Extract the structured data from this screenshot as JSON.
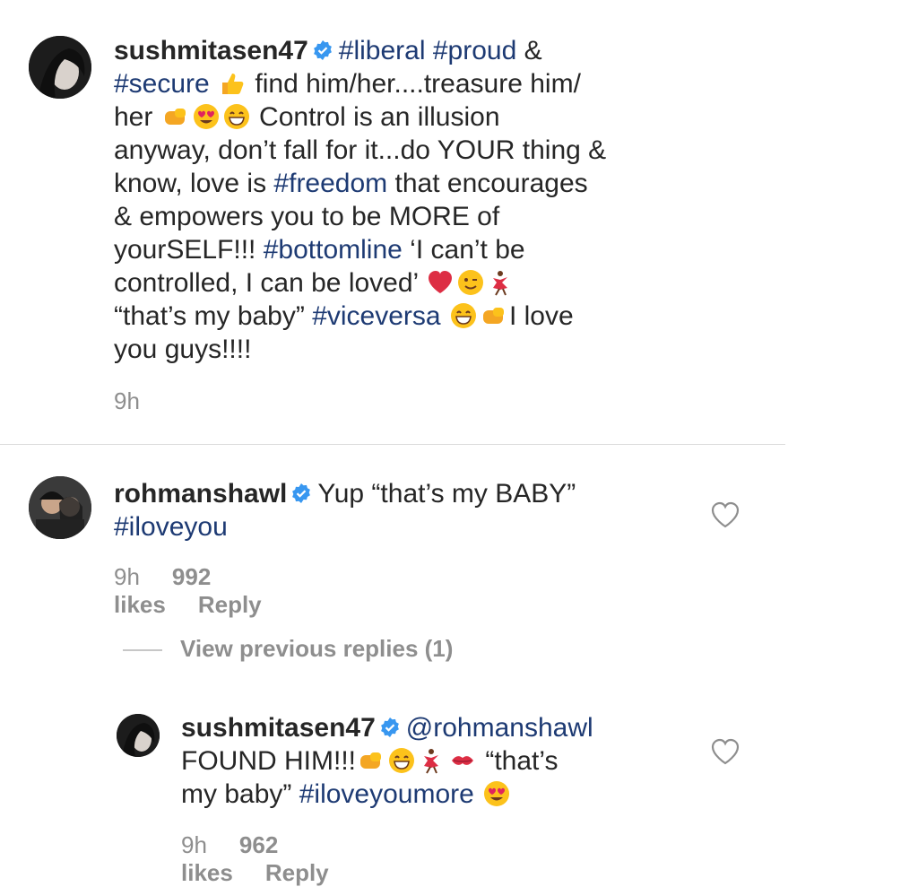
{
  "comment1": {
    "username": "sushmitasen47",
    "line1_tags": "#liberal #proud",
    "line1_amp": " &",
    "line2_tag": "#secure",
    "line2_text": " find him/her....treasure him/",
    "line3_text": "her",
    "line3_rest": " Control is an illusion",
    "line4": "anyway, don’t fall for it...do YOUR thing &",
    "line5_pre": "know, love is ",
    "line5_tag": "#freedom",
    "line5_post": " that encourages",
    "line6": "& empowers you to be MORE of",
    "line7_pre": "yourSELF!!! ",
    "line7_tag": "#bottomline",
    "line7_post": " ‘I can’t be",
    "line8": "controlled, I can be loved’",
    "line9_pre": "“that’s my baby” ",
    "line9_tag": "#viceversa",
    "line9_post": "I love",
    "line10": "you guys!!!!",
    "time": "9h"
  },
  "comment2": {
    "username": "rohmanshawl",
    "text": "Yup “that’s my BABY”",
    "tag": "#iloveyou",
    "time": "9h",
    "likes": "992 likes",
    "reply": "Reply"
  },
  "view_previous": "View previous replies (1)",
  "comment3": {
    "username": "sushmitasen47",
    "mention": "@rohmanshawl",
    "line2_text": "FOUND HIM!!!",
    "line2_quote": " “that’s",
    "line3_text": "my baby” ",
    "line3_tag": "#iloveyoumore",
    "time": "9h",
    "likes": "962 likes",
    "reply": "Reply"
  },
  "icons": {
    "verified": "verified-badge-icon",
    "heart": "heart-outline-icon"
  },
  "colors": {
    "hashtag": "#1d3a73",
    "verified": "#3897f0",
    "meta": "#8e8e8e"
  }
}
